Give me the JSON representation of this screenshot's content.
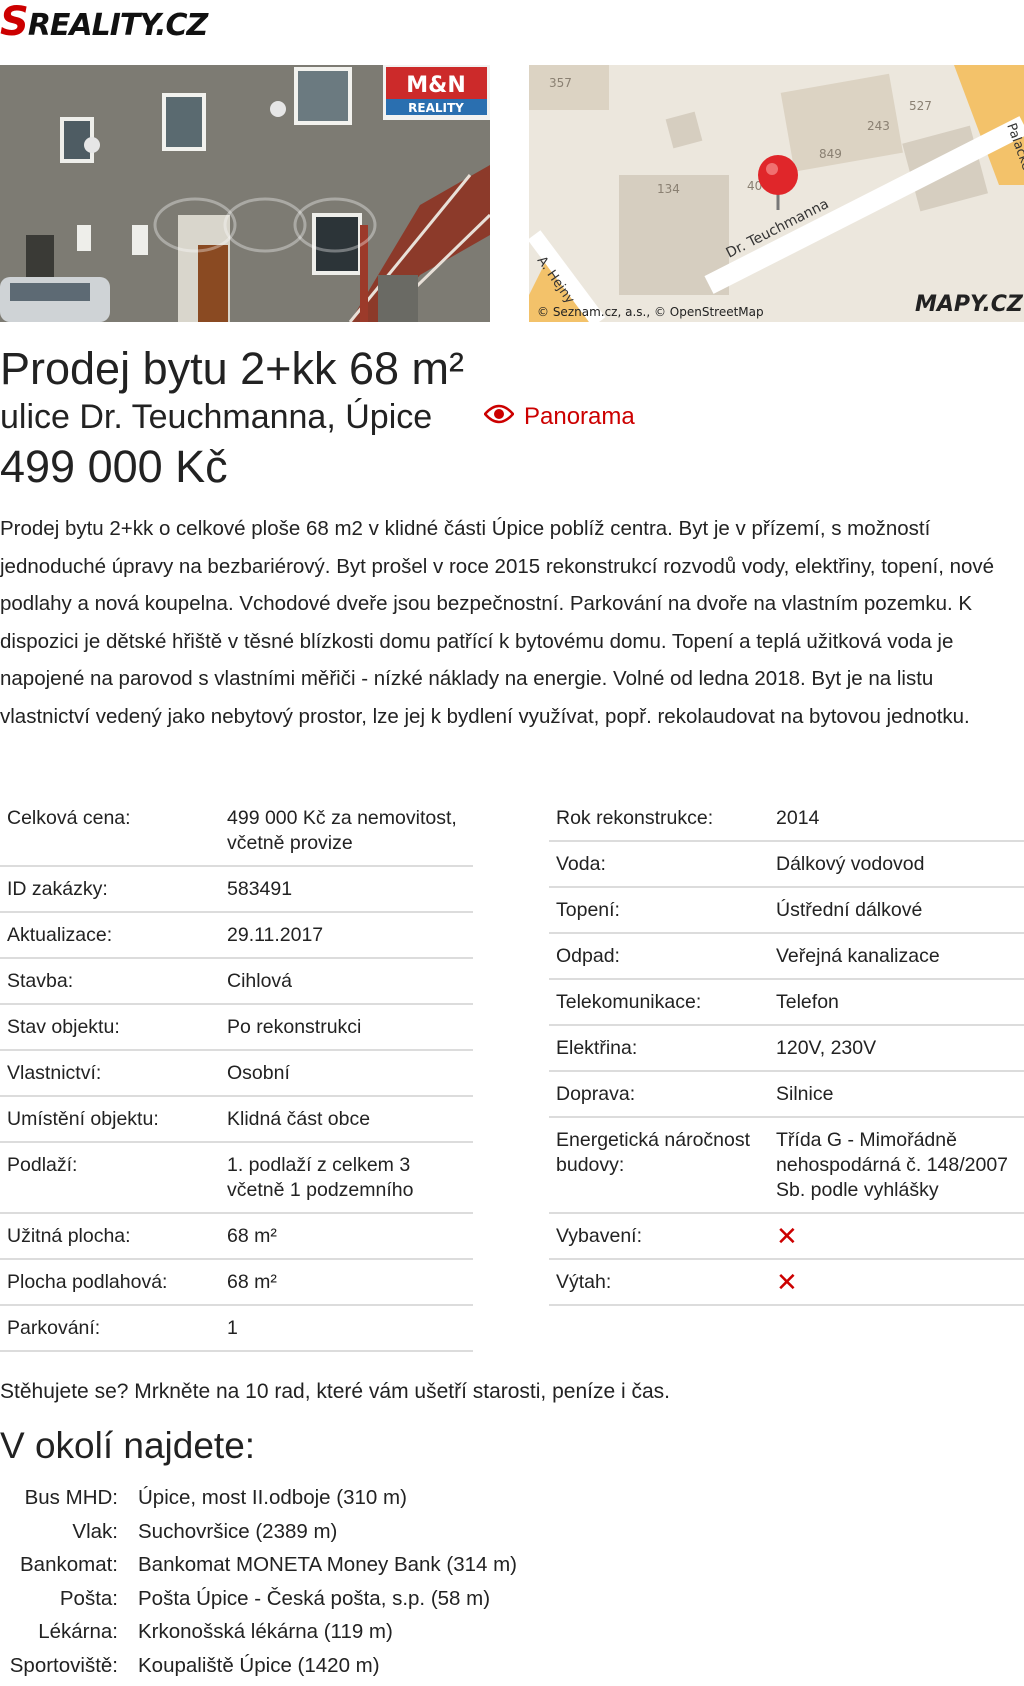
{
  "logo": {
    "s": "S",
    "rest": "REALITY.CZ"
  },
  "photo": {
    "watermark": "M&N REALITY"
  },
  "map": {
    "street": "Dr. Teuchmanna",
    "street2": "A. Hejny",
    "street3": "Palackého",
    "house_numbers": [
      "357",
      "527",
      "243",
      "849",
      "134",
      "40"
    ],
    "attribution": "© Seznam.cz, a.s., © OpenStreetMap",
    "brand": "MAPY.CZ"
  },
  "listing": {
    "title": "Prodej bytu 2+kk 68 m²",
    "address": "ulice Dr. Teuchmanna, Úpice",
    "price": "499 000 Kč",
    "panorama_label": "Panorama",
    "description": "Prodej bytu 2+kk o celkové ploše 68 m2 v klidné části Úpice poblíž centra. Byt je v přízemí, s možností jednoduché úpravy na bezbariérový. Byt prošel v roce 2015 rekonstrukcí rozvodů vody, elektřiny, topení, nové podlahy a nová koupelna. Vchodové dveře jsou bezpečnostní. Parkování na dvoře na vlastním pozemku. K dispozici je dětské hřiště v těsné blízkosti domu patřící k bytovému domu. Topení a teplá užitková voda je napojené na parovod s vlastními měřiči - nízké náklady na energie. Volné od ledna 2018. Byt je na listu vlastnictví vedený jako nebytový prostor, lze jej k bydlení využívat, popř. rekolaudovat na bytovou jednotku."
  },
  "params_left": [
    {
      "label": "Celková cena:",
      "value": "499 000 Kč za nemovitost, včetně provize"
    },
    {
      "label": "ID zakázky:",
      "value": "583491"
    },
    {
      "label": "Aktualizace:",
      "value": "29.11.2017"
    },
    {
      "label": "Stavba:",
      "value": "Cihlová"
    },
    {
      "label": "Stav objektu:",
      "value": "Po rekonstrukci"
    },
    {
      "label": "Vlastnictví:",
      "value": "Osobní"
    },
    {
      "label": "Umístění objektu:",
      "value": "Klidná část obce"
    },
    {
      "label": "Podlaží:",
      "value": "1. podlaží z celkem 3 včetně 1 podzemního"
    },
    {
      "label": "Užitná plocha:",
      "value": "68 m²"
    },
    {
      "label": "Plocha podlahová:",
      "value": "68 m²"
    },
    {
      "label": "Parkování:",
      "value": "1"
    }
  ],
  "params_right": [
    {
      "label": "Rok rekonstrukce:",
      "value": "2014"
    },
    {
      "label": "Voda:",
      "value": "Dálkový vodovod"
    },
    {
      "label": "Topení:",
      "value": "Ústřední dálkové"
    },
    {
      "label": "Odpad:",
      "value": "Veřejná kanalizace"
    },
    {
      "label": "Telekomunikace:",
      "value": "Telefon"
    },
    {
      "label": "Elektřina:",
      "value": "120V, 230V"
    },
    {
      "label": "Doprava:",
      "value": "Silnice"
    },
    {
      "label": "Energetická náročnost budovy:",
      "value": "Třída G - Mimořádně nehospodárná č. 148/2007 Sb. podle vyhlášky"
    },
    {
      "label": "Vybavení:",
      "value": "✕"
    },
    {
      "label": "Výtah:",
      "value": "✕"
    }
  ],
  "moving_text": "Stěhujete se? Mrkněte na 10 rad, které vám ušetří starosti, peníze i čas.",
  "okoli": {
    "heading": "V okolí najdete:",
    "items": [
      {
        "label": "Bus MHD:",
        "value": "Úpice, most II.odboje (310 m)"
      },
      {
        "label": "Vlak:",
        "value": "Suchovršice (2389 m)"
      },
      {
        "label": "Bankomat:",
        "value": "Bankomat MONETA Money Bank (314 m)"
      },
      {
        "label": "Pošta:",
        "value": "Pošta Úpice - Česká pošta, s.p. (58 m)"
      },
      {
        "label": "Lékárna:",
        "value": "Krkonošská lékárna (119 m)"
      },
      {
        "label": "Sportoviště:",
        "value": "Koupaliště Úpice (1420 m)"
      }
    ]
  },
  "colors": {
    "accent": "#cc0000",
    "divider": "#dcdcdc",
    "text": "#222222"
  }
}
